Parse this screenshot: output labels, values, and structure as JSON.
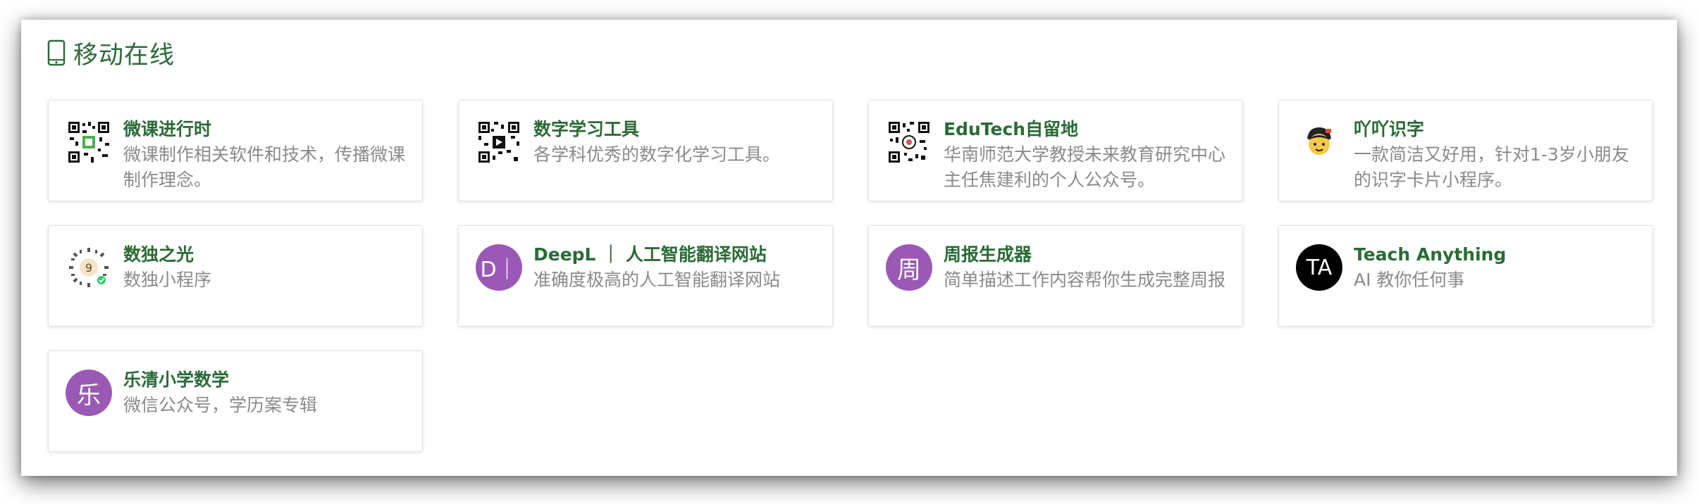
{
  "section": {
    "title": "移动在线",
    "icon": "mobile-phone-icon"
  },
  "colors": {
    "title_green": "#2d6a3a",
    "card_title_green": "#2a6b35",
    "desc_gray": "#8a8a8a",
    "avatar_purple": "#9b59b6",
    "avatar_black": "#000000"
  },
  "cards": [
    {
      "title": "微课进行时",
      "desc": "微课制作相关软件和技术，传播微课制作理念。",
      "icon": "qr-code-icon"
    },
    {
      "title": "数字学习工具",
      "desc": "各学科优秀的数字化学习工具。",
      "icon": "qr-code-icon"
    },
    {
      "title": "EduTech自留地",
      "desc": "华南师范大学教授未来教育研究中心主任焦建利的个人公众号。",
      "icon": "qr-code-icon"
    },
    {
      "title": "吖吖识字",
      "desc": "一款简洁又好用，针对1-3岁小朋友的识字卡片小程序。",
      "icon": "cartoon-kid-icon"
    },
    {
      "title": "数独之光",
      "desc": "数独小程序",
      "icon": "mini-program-code-icon"
    },
    {
      "title": "DeepL ｜ 人工智能翻译网站",
      "desc": "准确度极高的人工智能翻译网站",
      "icon_text": "D｜",
      "icon": "letter-avatar-icon"
    },
    {
      "title": "周报生成器",
      "desc": "简单描述工作内容帮你生成完整周报",
      "icon_text": "周",
      "icon": "letter-avatar-icon"
    },
    {
      "title": "Teach Anything",
      "desc": "AI 教你任何事",
      "icon_text": "TA",
      "icon": "letter-avatar-icon"
    },
    {
      "title": "乐清小学数学",
      "desc": "微信公众号，学历案专辑",
      "icon_text": "乐",
      "icon": "letter-avatar-icon"
    }
  ]
}
